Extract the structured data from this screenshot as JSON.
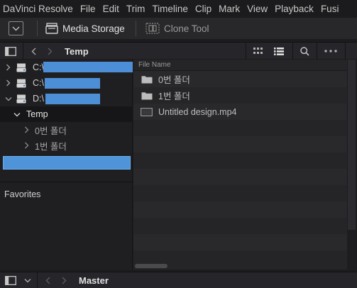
{
  "menu": [
    "DaVinci Resolve",
    "File",
    "Edit",
    "Trim",
    "Timeline",
    "Clip",
    "Mark",
    "View",
    "Playback",
    "Fusi"
  ],
  "toolbar": {
    "media_storage_label": "Media Storage",
    "clone_tool_label": "Clone Tool"
  },
  "pathbar": {
    "current_folder": "Temp"
  },
  "tree": {
    "drives": [
      {
        "label": "C:\\",
        "expanded": false
      },
      {
        "label": "C:\\",
        "expanded": false
      },
      {
        "label": "D:\\",
        "expanded": true
      }
    ],
    "folder": "Temp",
    "subfolders": [
      "0번 폴더",
      "1번 폴더"
    ]
  },
  "favorites_label": "Favorites",
  "files": {
    "column_header": "File Name",
    "items": [
      {
        "name": "0번 폴더",
        "type": "folder"
      },
      {
        "name": "1번 폴더",
        "type": "folder"
      },
      {
        "name": "Untitled design.mp4",
        "type": "video"
      }
    ]
  },
  "bottombar": {
    "bin_label": "Master"
  },
  "colors": {
    "accent": "#4c8fd6",
    "background": "#1c1c1e"
  }
}
